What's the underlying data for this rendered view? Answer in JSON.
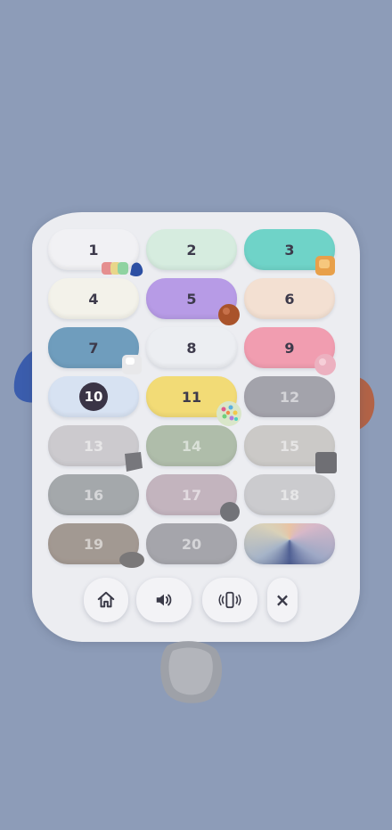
{
  "levels": [
    {
      "label": "1",
      "state": "unlocked",
      "color": "#f1f1f4"
    },
    {
      "label": "2",
      "state": "unlocked",
      "color": "#d6ecdf"
    },
    {
      "label": "3",
      "state": "unlocked",
      "color": "#6fd3c8"
    },
    {
      "label": "4",
      "state": "unlocked",
      "color": "#f3f2ea"
    },
    {
      "label": "5",
      "state": "unlocked",
      "color": "#b79be6"
    },
    {
      "label": "6",
      "state": "unlocked",
      "color": "#f3e0d2"
    },
    {
      "label": "7",
      "state": "unlocked",
      "color": "#6f9dbd"
    },
    {
      "label": "8",
      "state": "unlocked",
      "color": "#eceef2"
    },
    {
      "label": "9",
      "state": "unlocked",
      "color": "#f19db0"
    },
    {
      "label": "10",
      "state": "current",
      "color": "#d7e2f2"
    },
    {
      "label": "11",
      "state": "unlocked",
      "color": "#f2db76"
    },
    {
      "label": "12",
      "state": "locked",
      "color": "#9c9ba4"
    },
    {
      "label": "13",
      "state": "locked",
      "color": "#c9c7cb"
    },
    {
      "label": "14",
      "state": "locked",
      "color": "#a9b8a3"
    },
    {
      "label": "15",
      "state": "locked",
      "color": "#c8c6c3"
    },
    {
      "label": "16",
      "state": "locked",
      "color": "#9da1a4"
    },
    {
      "label": "17",
      "state": "locked",
      "color": "#bfaeb9"
    },
    {
      "label": "18",
      "state": "locked",
      "color": "#c8c8cb"
    },
    {
      "label": "19",
      "state": "locked",
      "color": "#9b9088"
    },
    {
      "label": "20",
      "state": "locked",
      "color": "#9e9ea4"
    },
    {
      "label": "",
      "state": "special",
      "color": "#c8b9b0"
    }
  ],
  "controls": {
    "home": "home-icon",
    "sound": "speaker-icon",
    "vibration": "vibration-icon",
    "close": "×"
  },
  "colors": {
    "background": "#8d9cb8",
    "panel": "#ecedf1",
    "text": "#3d3a4b"
  }
}
